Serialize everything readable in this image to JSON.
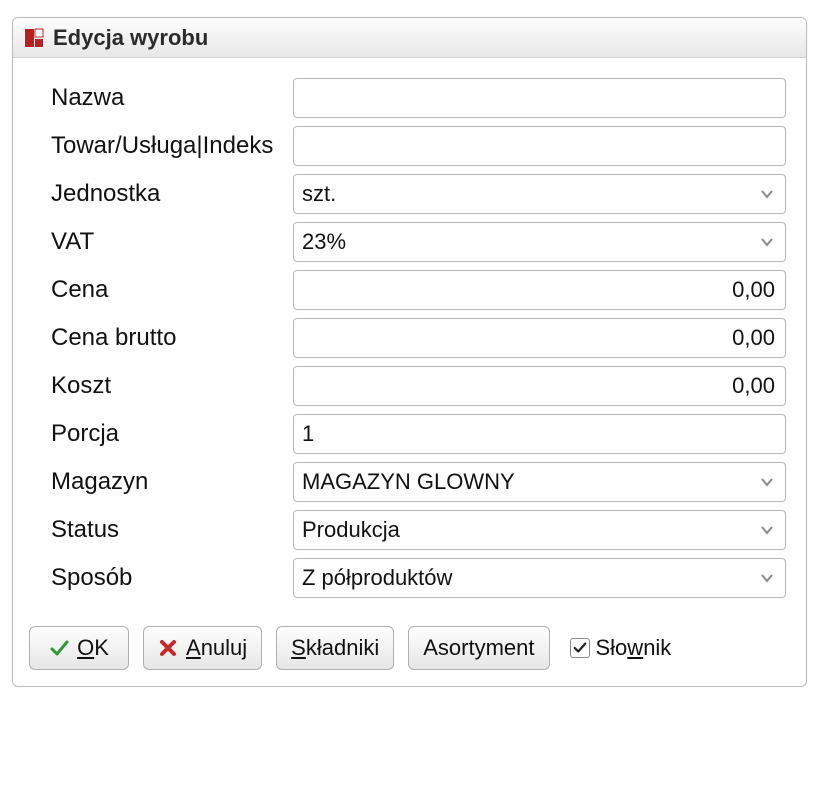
{
  "window": {
    "title": "Edycja wyrobu"
  },
  "form": {
    "nazwa": {
      "label": "Nazwa",
      "value": ""
    },
    "towarIndeks": {
      "label": "Towar/Usługa|Indeks",
      "value": ""
    },
    "jednostka": {
      "label": "Jednostka",
      "value": "szt."
    },
    "vat": {
      "label": "VAT",
      "value": "23%"
    },
    "cena": {
      "label": "Cena",
      "value": "0,00"
    },
    "cenaBrutto": {
      "label": "Cena brutto",
      "value": "0,00"
    },
    "koszt": {
      "label": "Koszt",
      "value": "0,00"
    },
    "porcja": {
      "label": "Porcja",
      "value": "1"
    },
    "magazyn": {
      "label": "Magazyn",
      "value": "MAGAZYN GLOWNY"
    },
    "status": {
      "label": "Status",
      "value": "Produkcja"
    },
    "sposob": {
      "label": "Sposób",
      "value": "Z półproduktów"
    }
  },
  "buttons": {
    "ok": {
      "pre": "",
      "mn": "O",
      "post": "K"
    },
    "anuluj": {
      "pre": "",
      "mn": "A",
      "post": "nuluj"
    },
    "skladniki": {
      "pre": "",
      "mn": "S",
      "post": "kładniki"
    },
    "asortyment": {
      "pre": "Asortyment",
      "mn": "",
      "post": ""
    },
    "slownik": {
      "pre": "Sło",
      "mn": "w",
      "post": "nik",
      "checked": true
    }
  }
}
